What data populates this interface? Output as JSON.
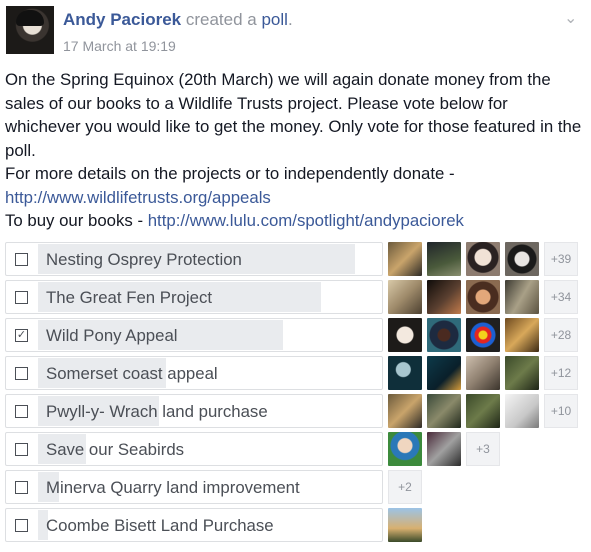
{
  "post": {
    "author": "Andy Paciorek",
    "action_prefix": "created a",
    "action_link": "poll",
    "action_suffix": ".",
    "timestamp": "17 March at 19:19",
    "body": [
      "On the Spring Equinox (20th March) we will again donate money from the sales of our books to a Wildlife Trusts project. Please vote below for whichever you would like to get the money. Only vote for those featured in the poll.",
      "For more details on the projects or to independently donate -",
      "http://www.wildlifetrusts.org/appeals"
    ],
    "buy_prefix": "To buy our books - ",
    "buy_url": "http://www.lulu.com/spotlight/andypaciorek"
  },
  "poll": {
    "options": [
      {
        "label": "Nesting Osprey Protection",
        "checked": false,
        "vote_fraction": 0.92,
        "voters": [
          "f1",
          "f2",
          "f3",
          "f4"
        ],
        "more": "+39"
      },
      {
        "label": "The Great Fen Project",
        "checked": false,
        "vote_fraction": 0.82,
        "voters": [
          "f5",
          "f6",
          "f7",
          "f8"
        ],
        "more": "+34"
      },
      {
        "label": "Wild Pony Appeal",
        "checked": true,
        "vote_fraction": 0.71,
        "voters": [
          "f9",
          "f10",
          "f11",
          "f12"
        ],
        "more": "+28"
      },
      {
        "label": "Somerset coast appeal",
        "checked": false,
        "vote_fraction": 0.37,
        "voters": [
          "f13",
          "f14",
          "f15",
          "f16"
        ],
        "more": "+12"
      },
      {
        "label": "Pwyll-y- Wrach land purchase",
        "checked": false,
        "vote_fraction": 0.35,
        "voters": [
          "f1",
          "f17",
          "f16",
          "f18"
        ],
        "more": "+10"
      },
      {
        "label": "Save our Seabirds",
        "checked": false,
        "vote_fraction": 0.14,
        "voters": [
          "f19",
          "f20"
        ],
        "more": "+3"
      },
      {
        "label": "Minerva Quarry land improvement",
        "checked": false,
        "vote_fraction": 0.06,
        "voters": [],
        "more": "+2"
      },
      {
        "label": "Coombe Bisett Land Purchase",
        "checked": false,
        "vote_fraction": 0.03,
        "voters": [
          "f21"
        ],
        "more": ""
      }
    ]
  }
}
